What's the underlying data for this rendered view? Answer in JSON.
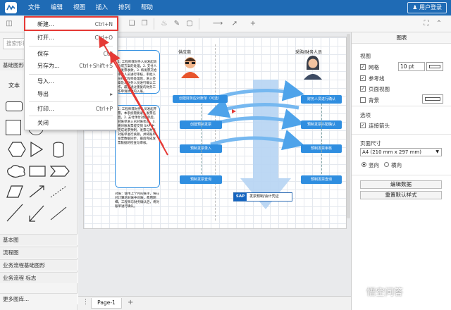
{
  "menubar": {
    "items": [
      "文件",
      "编辑",
      "视图",
      "插入",
      "排列",
      "帮助"
    ],
    "login": "用户登录"
  },
  "file_menu": {
    "items": [
      {
        "label": "新建...",
        "shortcut": "Ctrl+N"
      },
      {
        "label": "打开...",
        "shortcut": "Ctrl+O"
      },
      {
        "label": "保存",
        "shortcut": "Ctrl"
      },
      {
        "label": "另存为...",
        "shortcut": "Ctrl+Shift+S"
      },
      {
        "label": "导入...",
        "shortcut": ""
      },
      {
        "label": "导出",
        "shortcut": ""
      },
      {
        "label": "打印...",
        "shortcut": "Ctrl+P"
      },
      {
        "label": "关闭",
        "shortcut": ""
      }
    ]
  },
  "left_panel": {
    "search_placeholder": "搜索形状",
    "section_basic": "基础图形",
    "text_label": "文本",
    "categories": [
      "基本图",
      "流程图",
      "业务流程基础图形",
      "业务流程 标志"
    ],
    "more": "更多图库..."
  },
  "right_panel": {
    "title": "图表",
    "view_header": "视图",
    "grid": "网格",
    "grid_size": "10 pt",
    "guides": "参考线",
    "page_view": "页面视图",
    "background": "背景",
    "options_header": "选项",
    "connection_arrows": "连接箭头",
    "page_size_header": "页面尺寸",
    "page_size": "A4 (210 mm x 297 mm)",
    "portrait": "竖向",
    "landscape": "横向",
    "edit_data": "编辑数据",
    "reset_style": "重置默认样式"
  },
  "bottom": {
    "page_tab": "Page-1"
  },
  "diagram": {
    "supplier": "供应商",
    "purchaser": "采购/财务人员",
    "left_steps": [
      "创建财务应对账单（可选）",
      "创建预制发票",
      "预制发票录入",
      "预制发票查询"
    ],
    "right_steps": [
      "财务人员进行确认",
      "预制发票匹配确认",
      "预制发票审核",
      "预制发票查询"
    ],
    "sap": "SAP",
    "sap_label": "发票预制/会计凭证",
    "note_text": "1. 工程师或财务人员发起询价或方案的处理，2. 支付人员发票收款，3. 将发票交给审批人员进行审核，审批人员在工程师处理后，进入签章及与财务人员进行确认工作，最后通过重复的财务工作申请款项的入账。",
    "note2_text": "对账：使用上个月的账单，将在已计算的对账中对账，费用明细，工程师与财务确认后，将对账单进行确认。",
    "note3_text": "1. 工程师或财务人员发起开票，本系统需要录入发票信息。2. 支付预付对账单后，对账单进入已对账状态。3. 将对账发票提交到 SAP 中完成发票预制，发票与财务对账单进行关联，并将账单发票数据同步。最后完成发票数据的检查与审核。"
  },
  "watermark": "悟空问答"
}
